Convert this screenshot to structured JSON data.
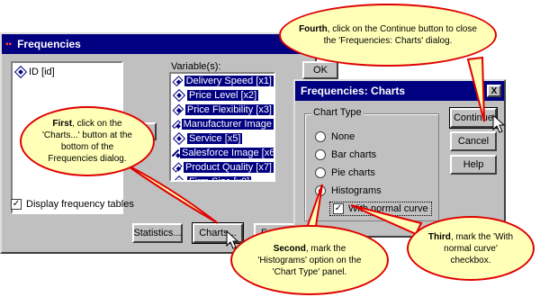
{
  "main_dialog": {
    "title": "Frequencies",
    "source_item": "ID [id]",
    "variables_label": "Variable(s):",
    "variables": [
      "Delivery Speed [x1]",
      "Price Level [x2]",
      "Price Flexibility [x3]",
      "Manufacturer Image",
      "Service [x5]",
      "Salesforce Image [x6]",
      "Product Quality [x7]",
      "Firm Size [x8]"
    ],
    "ok_label": "OK",
    "display_tables_label": "Display frequency tables",
    "statistics_label": "Statistics...",
    "charts_label": "Charts...",
    "format_label": "Fo"
  },
  "charts_dialog": {
    "title": "Frequencies: Charts",
    "close_glyph": "X",
    "chart_type_label": "Chart Type",
    "options": [
      "None",
      "Bar charts",
      "Pie charts",
      "Histograms"
    ],
    "normal_curve_label": "With normal curve",
    "continue_label": "Continue",
    "cancel_label": "Cancel",
    "help_label": "Help"
  },
  "callouts": {
    "first_bold": "First",
    "first_text": ", click on the 'Charts...' button at the bottom of the Frequencies dialog.",
    "second_bold": "Second",
    "second_text": ", mark the 'Histograms' option on the 'Chart Type' panel.",
    "third_bold": "Third",
    "third_text": ", mark the 'With normal curve' checkbox.",
    "fourth_bold": "Fourth",
    "fourth_text": ", click on the Continue button to close the 'Frequencies: Charts' dialog."
  },
  "colors": {
    "title_bar": "#000080",
    "dialog_bg": "#c0c0c0",
    "callout_fill": "#ffffb8",
    "callout_border": "#e00000"
  }
}
